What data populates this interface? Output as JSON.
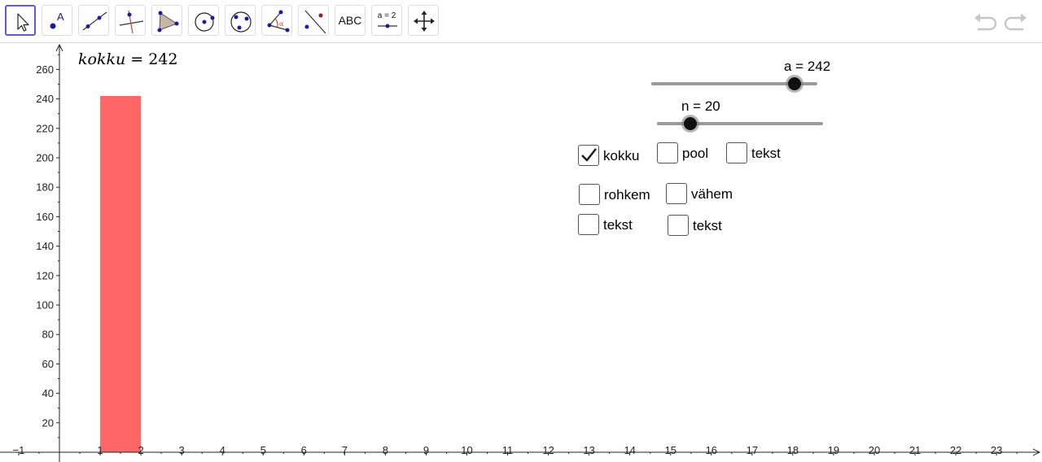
{
  "toolbar": {
    "tools": [
      {
        "name": "move",
        "icon": "arrow-pointer-icon",
        "selected": true
      },
      {
        "name": "point",
        "icon": "point-icon"
      },
      {
        "name": "line",
        "icon": "line-through-points-icon"
      },
      {
        "name": "perpendicular-line",
        "icon": "perpendicular-line-icon"
      },
      {
        "name": "polygon",
        "icon": "polygon-icon"
      },
      {
        "name": "circle-center-point",
        "icon": "circle-center-icon"
      },
      {
        "name": "circle-three-points",
        "icon": "circle-three-points-icon"
      },
      {
        "name": "angle",
        "icon": "angle-icon"
      },
      {
        "name": "reflect",
        "icon": "reflect-icon"
      },
      {
        "name": "text",
        "icon": "text-tool-icon",
        "label": "ABC"
      },
      {
        "name": "slider",
        "icon": "slider-tool-icon",
        "label": "a = 2"
      },
      {
        "name": "move-graphics-view",
        "icon": "move-graphics-icon"
      }
    ],
    "undo_icon": "undo-icon",
    "redo_icon": "redo-icon"
  },
  "graphics": {
    "kokku_name": "kokku",
    "kokku_eq": " = ",
    "kokku_value": "242",
    "sliders": [
      {
        "label": "a = 242",
        "min": 0,
        "max": 280,
        "value": 242
      },
      {
        "label": "n = 20",
        "min": 0,
        "max": 100,
        "value": 20
      }
    ],
    "checkboxes": [
      {
        "label": "kokku",
        "checked": true
      },
      {
        "label": "pool",
        "checked": false
      },
      {
        "label": "tekst",
        "checked": false
      },
      {
        "label": "rohkem",
        "checked": false
      },
      {
        "label": "vähem",
        "checked": false
      },
      {
        "label": "tekst",
        "checked": false
      },
      {
        "label": "tekst",
        "checked": false
      }
    ]
  },
  "chart_data": {
    "type": "bar",
    "bars": [
      {
        "x_start": 1,
        "x_end": 2,
        "value": 242
      }
    ],
    "bar_color": "#ff6666",
    "xlim": [
      -1.5,
      24.5
    ],
    "ylim": [
      0,
      270
    ],
    "x_ticks": [
      "−1",
      "1",
      "2",
      "3",
      "4",
      "5",
      "6",
      "7",
      "8",
      "9",
      "10",
      "11",
      "12",
      "13",
      "14",
      "15",
      "16",
      "17",
      "18",
      "19",
      "20",
      "21",
      "22",
      "23"
    ],
    "y_ticks": [
      "20",
      "40",
      "60",
      "80",
      "100",
      "120",
      "140",
      "160",
      "180",
      "200",
      "220",
      "240",
      "260"
    ],
    "grid": false
  }
}
